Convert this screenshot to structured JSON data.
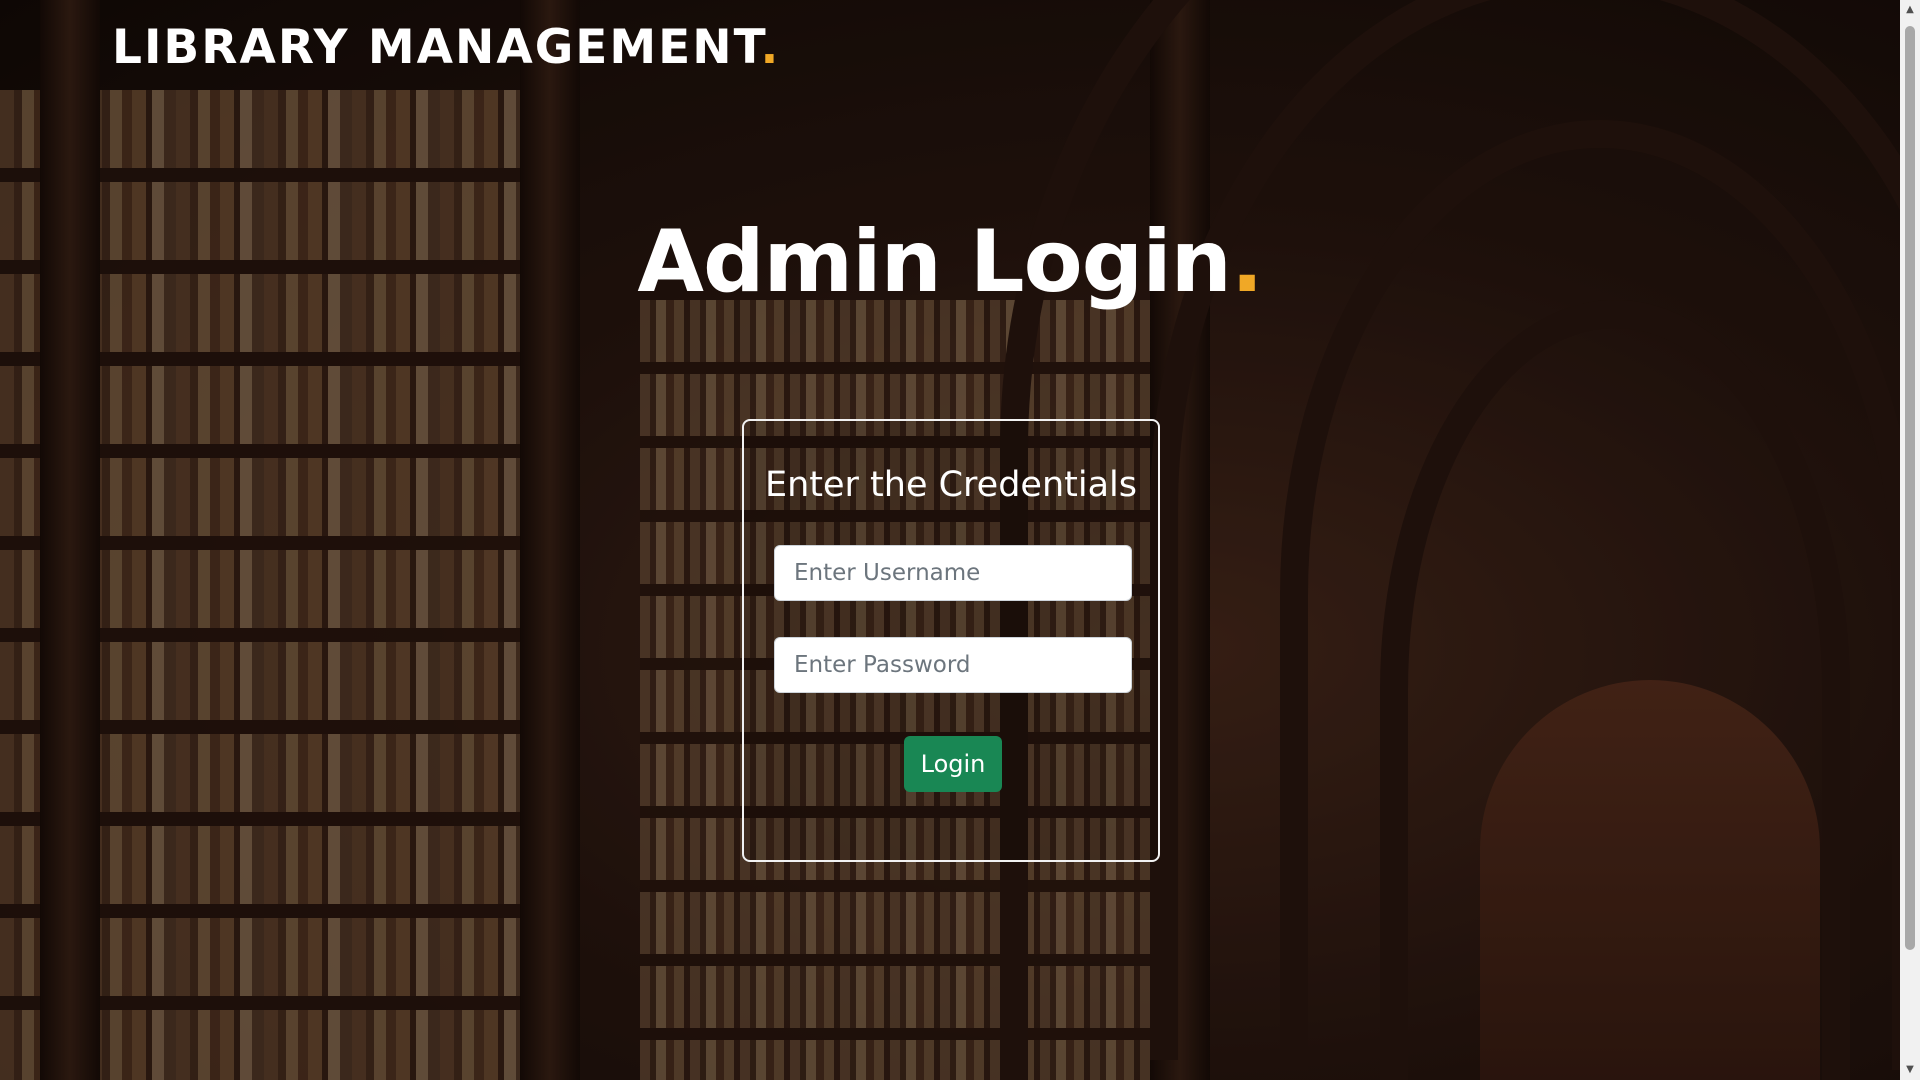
{
  "header": {
    "brand": "LIBRARY MANAGEMENT",
    "brand_dot": "."
  },
  "page": {
    "title": "Admin Login",
    "title_dot": "."
  },
  "login_form": {
    "heading": "Enter the Credentials",
    "username": {
      "value": "",
      "placeholder": "Enter Username"
    },
    "password": {
      "value": "",
      "placeholder": "Enter Password"
    },
    "submit_label": "Login"
  },
  "scrollbar": {
    "up_icon": "▲",
    "down_icon": "▼"
  },
  "colors": {
    "accent": "#f0a826",
    "button": "#198754",
    "text": "#ffffff"
  },
  "icons": [
    "scroll-up-arrow-icon",
    "scroll-down-arrow-icon"
  ]
}
